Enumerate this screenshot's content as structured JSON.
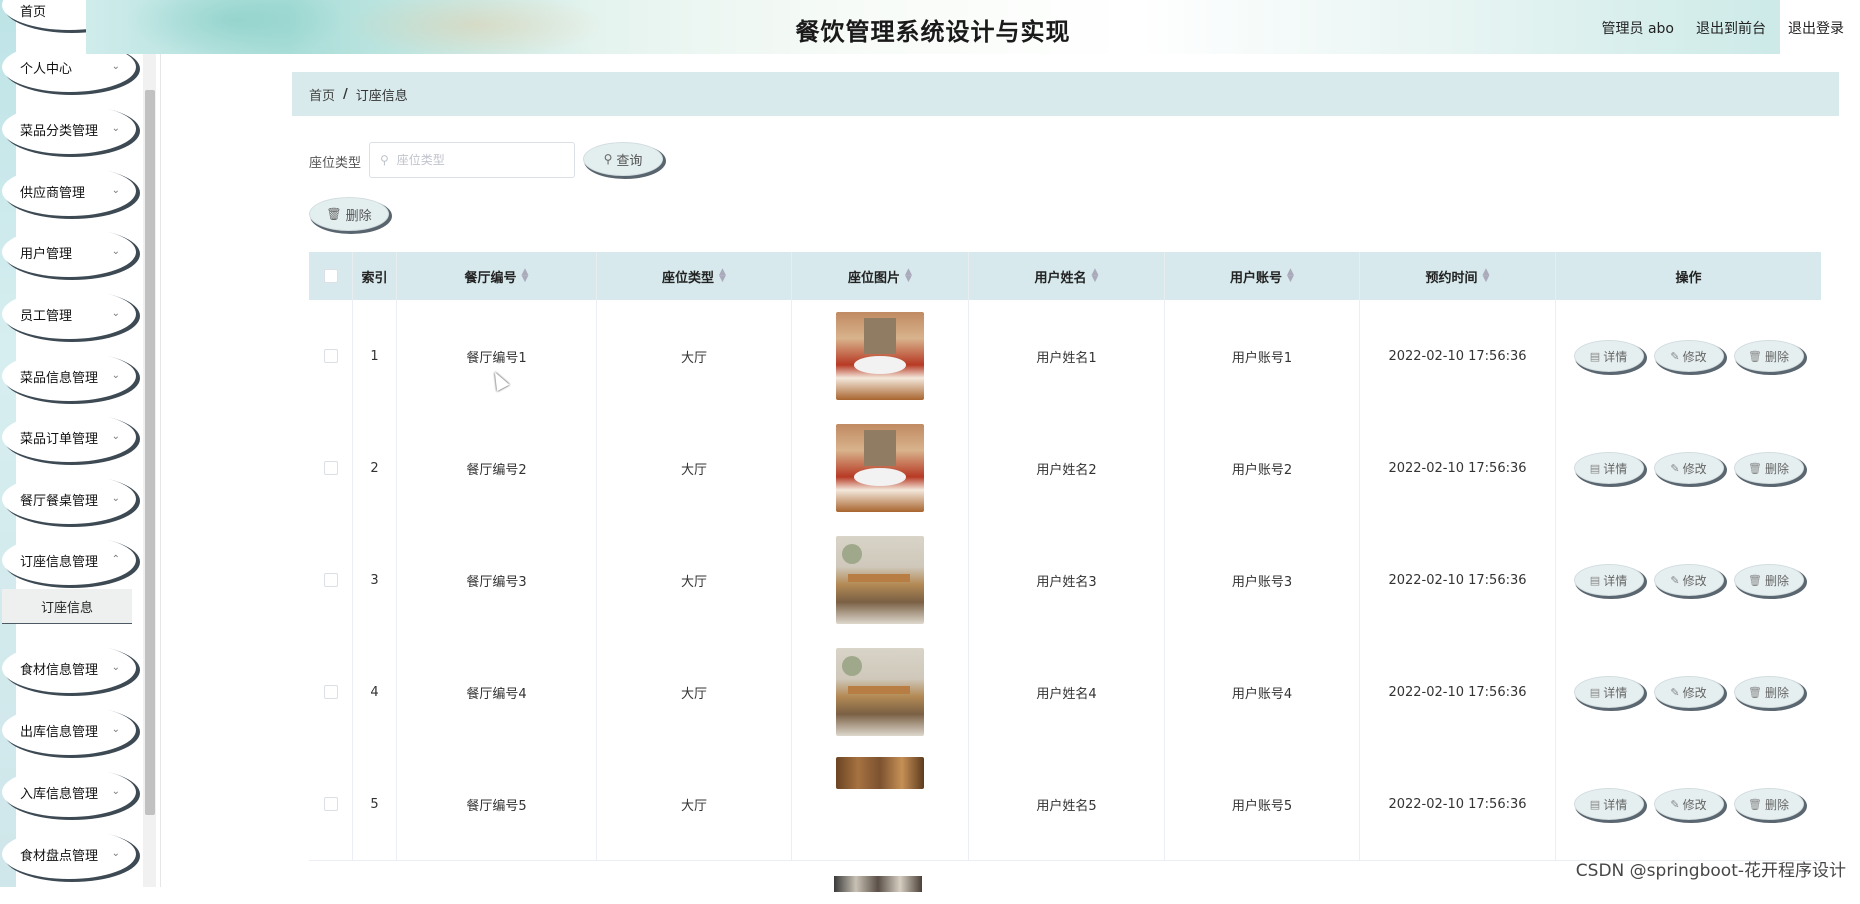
{
  "app": {
    "title": "餐饮管理系统设计与实现"
  },
  "header": {
    "admin": "管理员 abo",
    "to_front": "退出到前台",
    "logout": "退出登录"
  },
  "sidebar": {
    "items": [
      {
        "label": "首页"
      },
      {
        "label": "个人中心"
      },
      {
        "label": "菜品分类管理"
      },
      {
        "label": "供应商管理"
      },
      {
        "label": "用户管理"
      },
      {
        "label": "员工管理"
      },
      {
        "label": "菜品信息管理"
      },
      {
        "label": "菜品订单管理"
      },
      {
        "label": "餐厅餐桌管理"
      },
      {
        "label": "订座信息管理"
      },
      {
        "label": "食材信息管理"
      },
      {
        "label": "出库信息管理"
      },
      {
        "label": "入库信息管理"
      },
      {
        "label": "食材盘点管理"
      }
    ],
    "active_sub": "订座信息"
  },
  "breadcrumb": {
    "home": "首页",
    "sep": "/",
    "current": "订座信息"
  },
  "search": {
    "label": "座位类型",
    "placeholder": "座位类型",
    "button": "查询"
  },
  "toolbar": {
    "delete": "删除"
  },
  "table": {
    "headers": {
      "index": "索引",
      "restaurant_no": "餐厅编号",
      "seat_type": "座位类型",
      "seat_image": "座位图片",
      "user_name": "用户姓名",
      "user_account": "用户账号",
      "reserve_time": "预约时间",
      "ops": "操作"
    },
    "actions": {
      "detail": "详情",
      "edit": "修改",
      "delete": "删除"
    },
    "rows": [
      {
        "index": "1",
        "restaurant_no": "餐厅编号1",
        "seat_type": "大厅",
        "user_name": "用户姓名1",
        "user_account": "用户账号1",
        "reserve_time": "2022-02-10 17:56:36"
      },
      {
        "index": "2",
        "restaurant_no": "餐厅编号2",
        "seat_type": "大厅",
        "user_name": "用户姓名2",
        "user_account": "用户账号2",
        "reserve_time": "2022-02-10 17:56:36"
      },
      {
        "index": "3",
        "restaurant_no": "餐厅编号3",
        "seat_type": "大厅",
        "user_name": "用户姓名3",
        "user_account": "用户账号3",
        "reserve_time": "2022-02-10 17:56:36"
      },
      {
        "index": "4",
        "restaurant_no": "餐厅编号4",
        "seat_type": "大厅",
        "user_name": "用户姓名4",
        "user_account": "用户账号4",
        "reserve_time": "2022-02-10 17:56:36"
      },
      {
        "index": "5",
        "restaurant_no": "餐厅编号5",
        "seat_type": "大厅",
        "user_name": "用户姓名5",
        "user_account": "用户账号5",
        "reserve_time": "2022-02-10 17:56:36"
      }
    ]
  },
  "watermark": "CSDN @springboot-花开程序设计"
}
